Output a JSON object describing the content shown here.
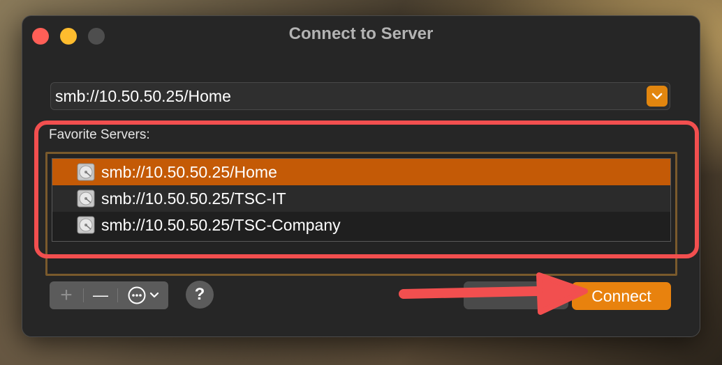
{
  "window": {
    "title": "Connect to Server"
  },
  "address": {
    "value": "smb://10.50.50.25/Home",
    "dropdown_icon": "chevron-down-icon"
  },
  "favorites": {
    "label": "Favorite Servers:",
    "items": [
      {
        "label": "smb://10.50.50.25/Home",
        "icon": "server-drive-icon",
        "selected": true
      },
      {
        "label": "smb://10.50.50.25/TSC-IT",
        "icon": "server-drive-icon",
        "selected": false
      },
      {
        "label": "smb://10.50.50.25/TSC-Company",
        "icon": "server-drive-icon",
        "selected": false
      }
    ]
  },
  "toolbar": {
    "add_label": "+",
    "remove_label": "—",
    "more_icon": "ellipsis-circle-icon"
  },
  "help": {
    "label": "?"
  },
  "buttons": {
    "connect_label": "Connect"
  },
  "colors": {
    "accent": "#e8820e",
    "selection": "#c45a06",
    "annotation": "#f24f4f"
  }
}
